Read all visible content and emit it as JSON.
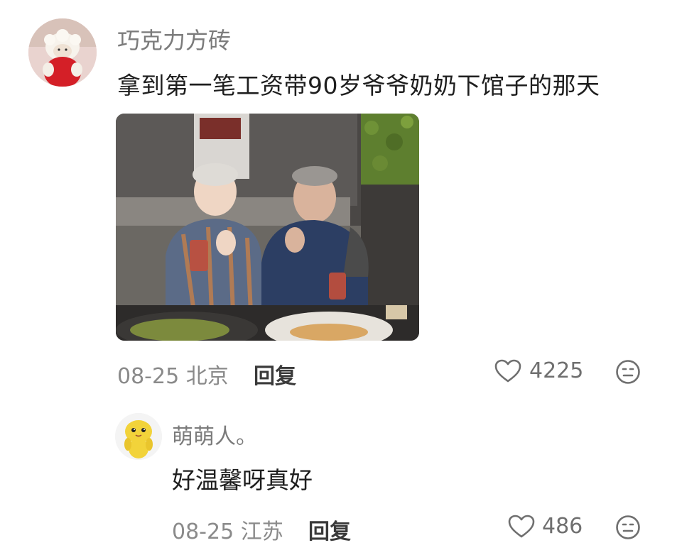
{
  "comments": [
    {
      "username": "巧克力方砖",
      "text": "拿到第一笔工资带90岁爷爷奶奶下馆子的那天",
      "date_location": "08-25 北京",
      "reply_label": "回复",
      "likes": "4225",
      "avatar_icon": "lamb-plush-avatar",
      "photo_icon": "photo-elderly-couple-thumbs-up"
    },
    {
      "username": "萌萌人。",
      "text": "好温馨呀真好",
      "date_location": "08-25 江苏",
      "reply_label": "回复",
      "likes": "486",
      "avatar_icon": "yellow-duck-avatar"
    }
  ],
  "colors": {
    "username": "#7b7b7b",
    "text": "#1e1e1e",
    "meta": "#8a8a8a",
    "reply": "#3a3a3a",
    "icon": "#6f6f6f"
  }
}
